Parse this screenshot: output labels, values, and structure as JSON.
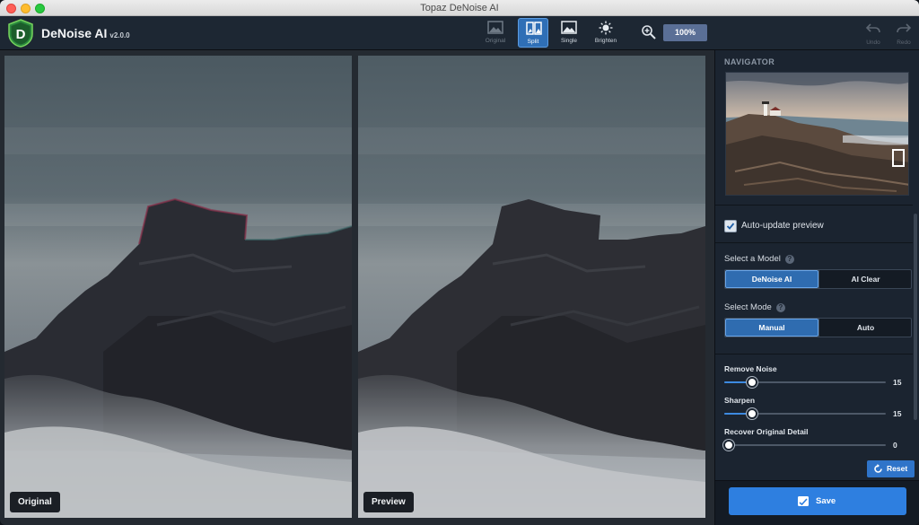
{
  "window": {
    "title": "Topaz DeNoise AI"
  },
  "app": {
    "name": "DeNoise AI",
    "version": "v2.0.0"
  },
  "toolbar": {
    "views": [
      {
        "label": "Original",
        "icon": "image-icon",
        "state": "disabled"
      },
      {
        "label": "Split",
        "icon": "split-view-icon",
        "state": "active"
      },
      {
        "label": "Single",
        "icon": "image-icon",
        "state": "normal"
      },
      {
        "label": "Brighten",
        "icon": "sun-icon",
        "state": "normal"
      }
    ],
    "zoom": "100%",
    "undo_label": "Undo",
    "redo_label": "Redo"
  },
  "panes": {
    "left_label": "Original",
    "right_label": "Preview"
  },
  "sidebar": {
    "navigator_title": "NAVIGATOR",
    "auto_update": {
      "label": "Auto-update preview",
      "checked": true
    },
    "model": {
      "title": "Select a Model",
      "options": [
        "DeNoise AI",
        "AI Clear"
      ],
      "selected": "DeNoise AI"
    },
    "mode": {
      "title": "Select Mode",
      "options": [
        "Manual",
        "Auto"
      ],
      "selected": "Manual"
    },
    "sliders": [
      {
        "label": "Remove Noise",
        "value": "15",
        "fraction": 0.17
      },
      {
        "label": "Sharpen",
        "value": "15",
        "fraction": 0.17
      },
      {
        "label": "Recover Original Detail",
        "value": "0",
        "fraction": 0.03
      }
    ],
    "reset_label": "Reset",
    "save_label": "Save"
  },
  "colors": {
    "accent": "#2e7fe0",
    "active_view": "#2f6fb6"
  }
}
